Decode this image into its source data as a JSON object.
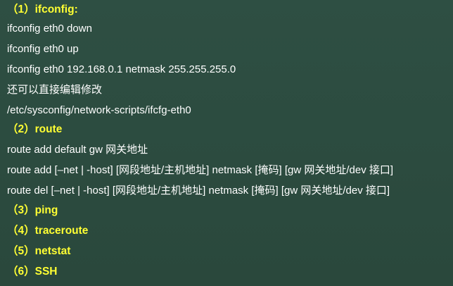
{
  "lines": [
    {
      "kind": "heading",
      "text": "（1）ifconfig:"
    },
    {
      "kind": "text",
      "text": "ifconfig eth0 down"
    },
    {
      "kind": "text",
      "text": "ifconfig eth0 up"
    },
    {
      "kind": "text",
      "text": "ifconfig eth0 192.168.0.1 netmask 255.255.255.0"
    },
    {
      "kind": "text",
      "text": "还可以直接编辑修改"
    },
    {
      "kind": "text",
      "text": "/etc/sysconfig/network-scripts/ifcfg-eth0"
    },
    {
      "kind": "heading",
      "text": "（2）route"
    },
    {
      "kind": "text",
      "text": "route add default gw  网关地址"
    },
    {
      "kind": "text",
      "text": "route add [–net | -host] [网段地址/主机地址] netmask [掩码] [gw 网关地址/dev 接口]"
    },
    {
      "kind": "text",
      "text": "route del  [–net | -host] [网段地址/主机地址] netmask [掩码] [gw 网关地址/dev 接口]"
    },
    {
      "kind": "heading",
      "text": "（3）ping"
    },
    {
      "kind": "heading",
      "text": "（4）traceroute"
    },
    {
      "kind": "heading",
      "text": "（5）netstat"
    },
    {
      "kind": "heading",
      "text": "（6）SSH"
    }
  ],
  "colors": {
    "background": "#2b4a3f",
    "heading": "#ffff33",
    "text": "#ffffff"
  }
}
